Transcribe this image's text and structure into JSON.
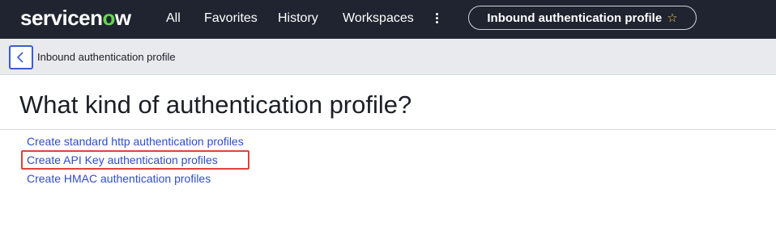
{
  "brand": {
    "logo_pre": "servicen",
    "logo_o": "o",
    "logo_post": "w",
    "accent": "#62d84e"
  },
  "topnav": {
    "items": [
      {
        "label": "All"
      },
      {
        "label": "Favorites"
      },
      {
        "label": "History"
      },
      {
        "label": "Workspaces"
      }
    ],
    "more_icon": "vertical-ellipsis-icon",
    "context_pill": {
      "label": "Inbound authentication profile",
      "icon": "star-icon"
    }
  },
  "subheader": {
    "back_icon": "chevron-left-icon",
    "title": "Inbound authentication profile"
  },
  "main": {
    "title": "What kind of authentication profile?",
    "links": [
      {
        "label": "Create standard http authentication profiles"
      },
      {
        "label": "Create API Key authentication profiles"
      },
      {
        "label": "Create HMAC authentication profiles"
      }
    ]
  },
  "colors": {
    "nav_bg": "#1f2430",
    "link": "#2f4dc6",
    "highlight": "#e0413b",
    "focus": "#3b5bd6"
  }
}
